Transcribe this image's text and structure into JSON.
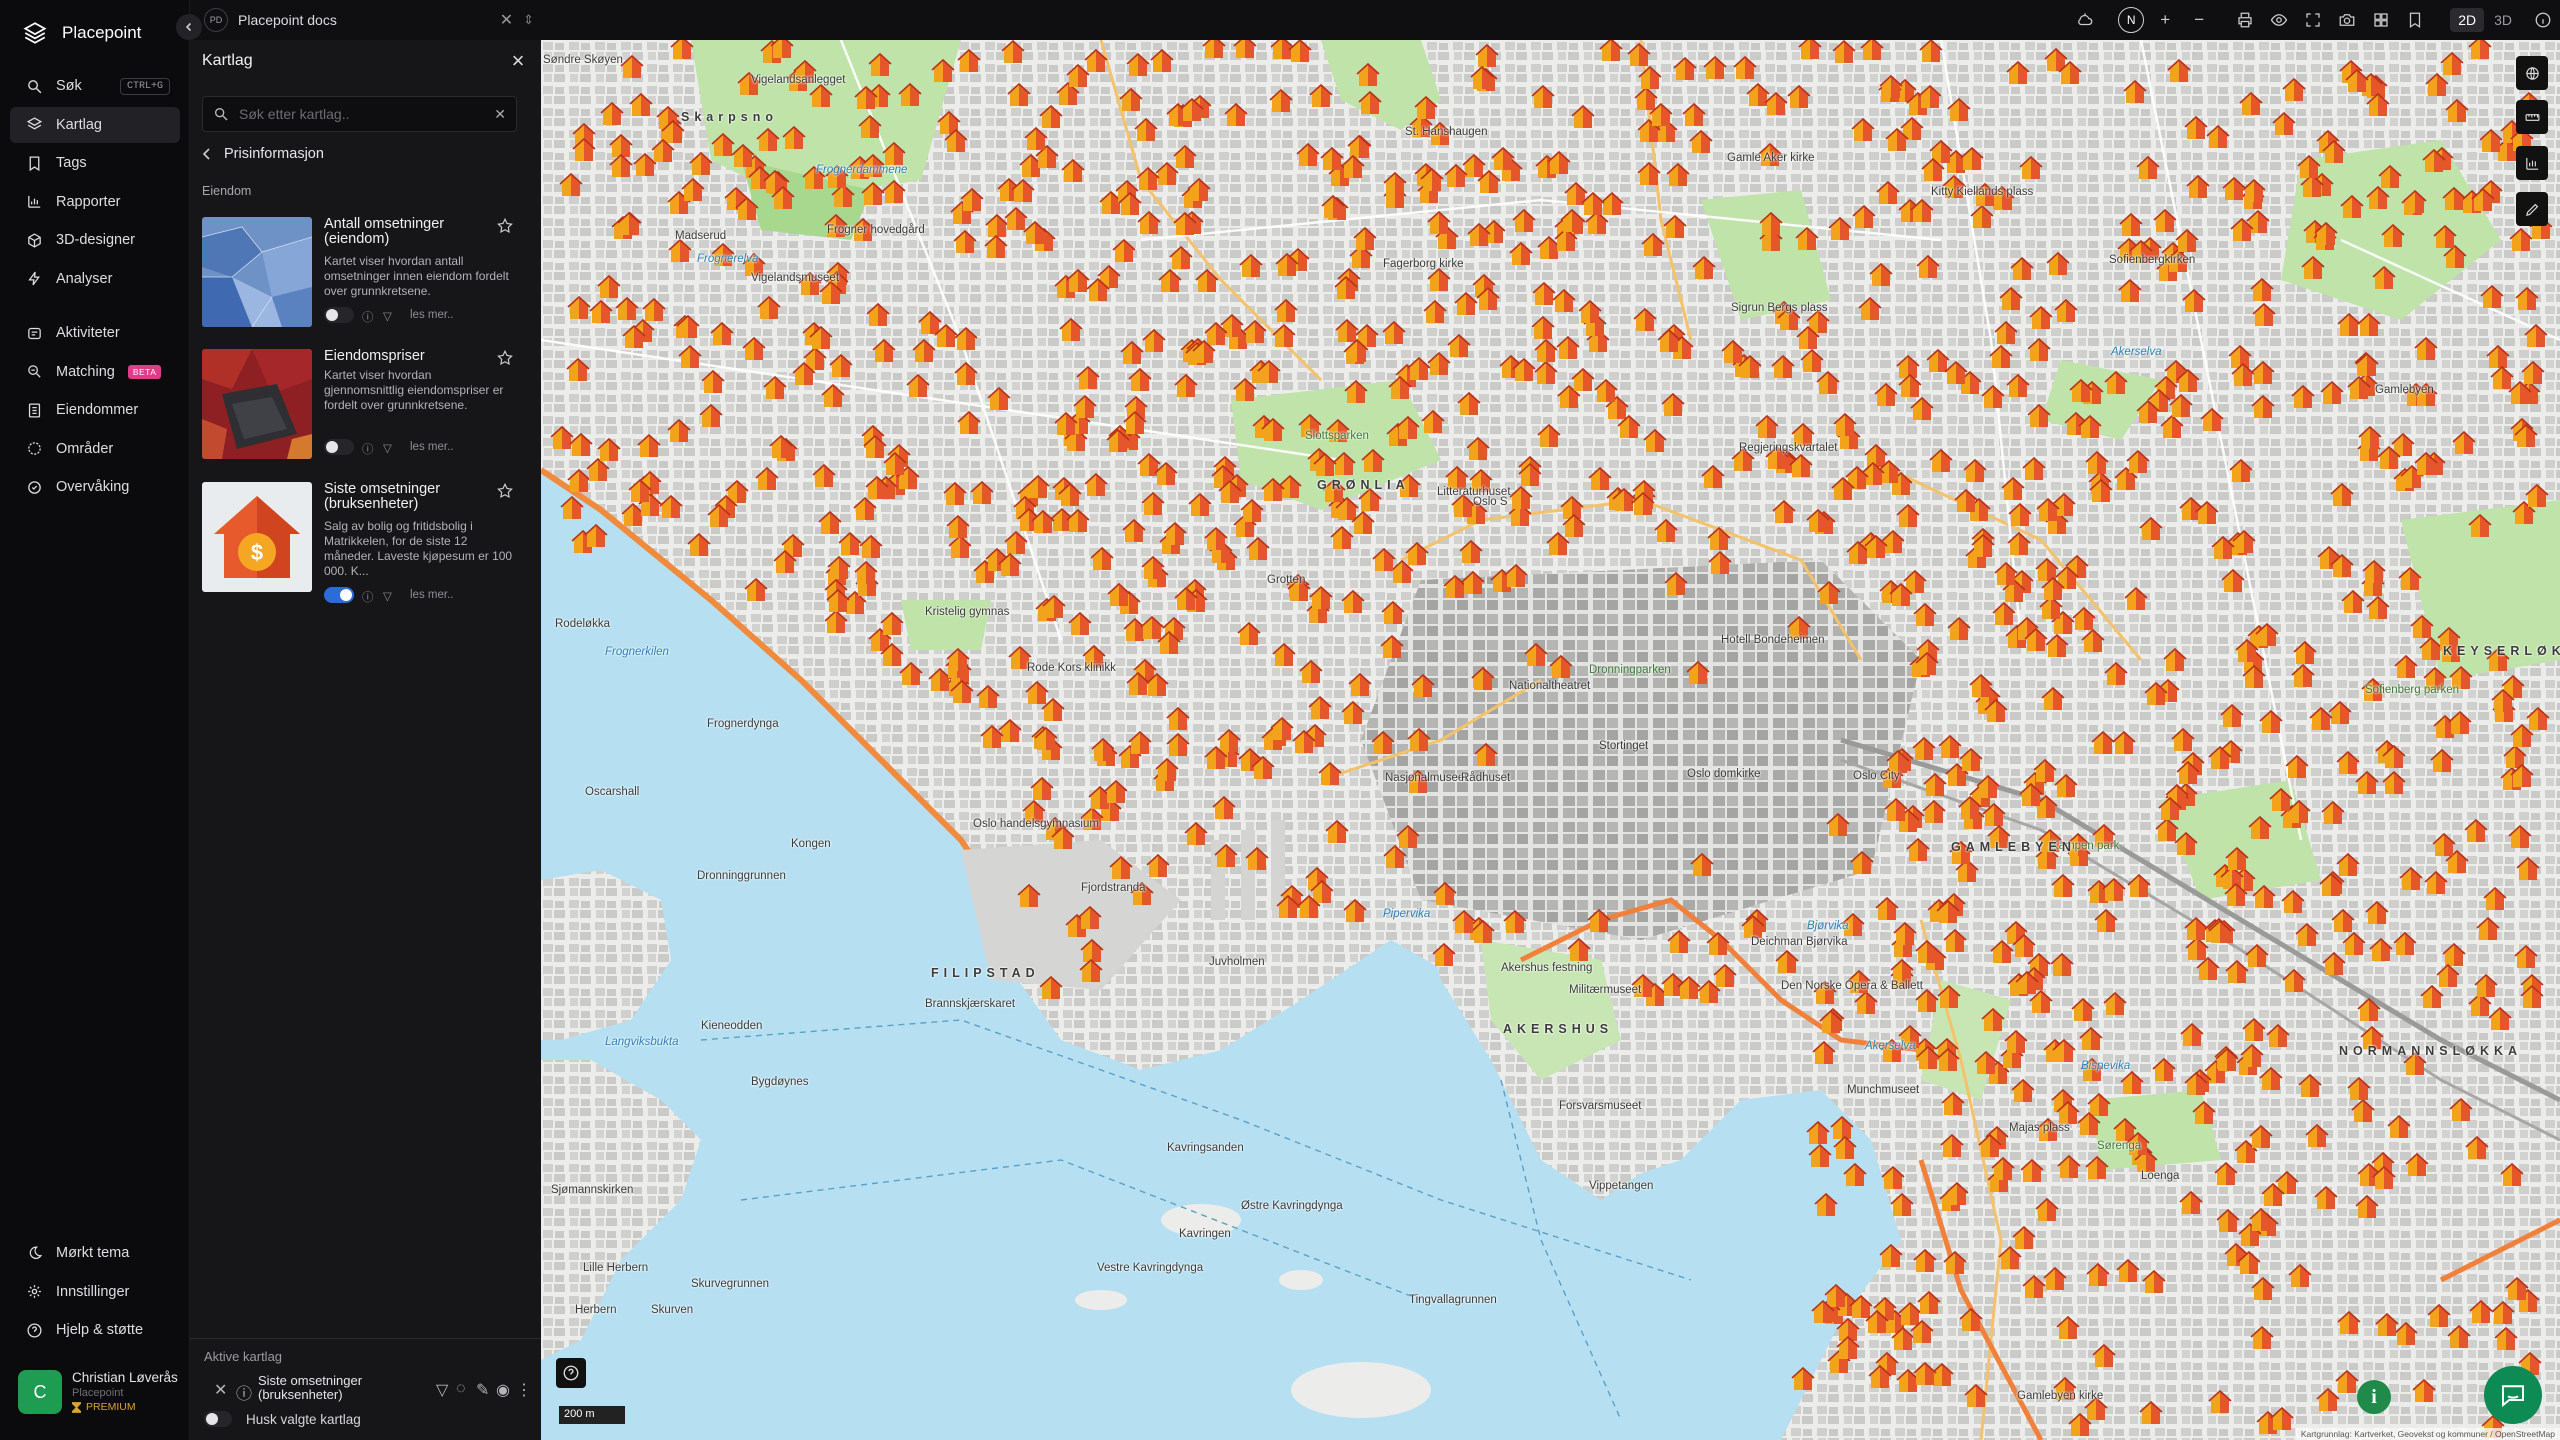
{
  "app": {
    "name": "Placepoint"
  },
  "nav": {
    "items": [
      {
        "label": "Søk",
        "shortcut": "CTRL+G",
        "icon": "search-icon"
      },
      {
        "label": "Kartlag",
        "icon": "layers-icon",
        "active": true
      },
      {
        "label": "Tags",
        "icon": "bookmark-icon"
      },
      {
        "label": "Rapporter",
        "icon": "bar-chart-icon"
      },
      {
        "label": "3D-designer",
        "icon": "cube-icon"
      },
      {
        "label": "Analyser",
        "icon": "bolt-icon"
      }
    ],
    "items2": [
      {
        "label": "Aktiviteter",
        "icon": "activity-icon"
      },
      {
        "label": "Matching",
        "badge": "BETA",
        "icon": "matching-icon"
      },
      {
        "label": "Eiendommer",
        "icon": "building-icon"
      },
      {
        "label": "Områder",
        "icon": "area-icon"
      },
      {
        "label": "Overvåking",
        "icon": "monitor-icon"
      }
    ],
    "bottom": [
      {
        "label": "Mørkt tema",
        "icon": "moon-icon"
      },
      {
        "label": "Innstillinger",
        "icon": "gear-icon"
      },
      {
        "label": "Hjelp & støtte",
        "icon": "help-icon"
      }
    ],
    "user": {
      "initial": "C",
      "name": "Christian Løverås",
      "org": "Placepoint",
      "plan": "PREMIUM"
    }
  },
  "tab": {
    "badge": "PD",
    "title": "Placepoint docs"
  },
  "toolbar": {
    "north": "N",
    "dim2": "2D",
    "dim3": "3D"
  },
  "panel": {
    "title": "Kartlag",
    "search_placeholder": "Søk etter kartlag..",
    "breadcrumb": "Prisinformasjon",
    "section": "Eiendom",
    "cards": [
      {
        "title": "Antall omsetninger (eiendom)",
        "desc": "Kartet viser hvordan antall omsetninger innen eiendom fordelt over grunnkretsene.",
        "more": "les mer..",
        "enabled": false
      },
      {
        "title": "Eiendomspriser",
        "desc": "Kartet viser hvordan gjennomsnittlig eiendomspriser er fordelt over grunnkretsene.",
        "more": "les mer..",
        "enabled": false
      },
      {
        "title": "Siste omsetninger (bruksenheter)",
        "desc": "Salg av bolig og fritidsbolig i Matrikkelen, for de siste 12 måneder. Laveste kjøpesum er 100 000. K...",
        "more": "les mer..",
        "enabled": true
      }
    ],
    "active_title": "Aktive kartlag",
    "active_layer": "Siste omsetninger (bruksenheter)",
    "remember": "Husk valgte kartlag"
  },
  "map": {
    "scale": "200 m",
    "attribution": "Kartgrunnlag: Kartverket, Geovekst og kommuner / OpenStreetMap",
    "labels": [
      {
        "t": "Søndre Skøyen",
        "c": ""
      },
      {
        "t": "Vigelandsanlegget",
        "c": ""
      },
      {
        "t": "Skarpsno",
        "c": "district"
      },
      {
        "t": "Frognerdammene",
        "c": "water"
      },
      {
        "t": "Madserud",
        "c": ""
      },
      {
        "t": "Frognerelva",
        "c": "water"
      },
      {
        "t": "Frogner hovedgård",
        "c": ""
      },
      {
        "t": "Vigelandsmuseet",
        "c": ""
      },
      {
        "t": "Frognerkilen",
        "c": "water"
      },
      {
        "t": "Rodeløkka",
        "c": ""
      },
      {
        "t": "Frognerdynga",
        "c": ""
      },
      {
        "t": "Oscarshall",
        "c": ""
      },
      {
        "t": "Kongen",
        "c": ""
      },
      {
        "t": "Dronninggrunnen",
        "c": ""
      },
      {
        "t": "Langviksbukta",
        "c": "water"
      },
      {
        "t": "Kieneodden",
        "c": ""
      },
      {
        "t": "Bygdøynes",
        "c": ""
      },
      {
        "t": "Sjømannskirken",
        "c": ""
      },
      {
        "t": "Lille Herbern",
        "c": ""
      },
      {
        "t": "Herbern",
        "c": ""
      },
      {
        "t": "Skurvegrunnen",
        "c": ""
      },
      {
        "t": "Skurven",
        "c": ""
      },
      {
        "t": "FILIPSTAD",
        "c": "district"
      },
      {
        "t": "Brannskjærskaret",
        "c": ""
      },
      {
        "t": "Juvholmen",
        "c": ""
      },
      {
        "t": "Kavringsanden",
        "c": ""
      },
      {
        "t": "Kavringen",
        "c": ""
      },
      {
        "t": "Østre Kavringdynga",
        "c": ""
      },
      {
        "t": "Vestre Kavringdynga",
        "c": ""
      },
      {
        "t": "Tingvallagrunnen",
        "c": ""
      },
      {
        "t": "Pipervika",
        "c": "water"
      },
      {
        "t": "AKERSHUS",
        "c": "district"
      },
      {
        "t": "Akershus festning",
        "c": ""
      },
      {
        "t": "Militærmuseet",
        "c": ""
      },
      {
        "t": "Forsvarsmuseet",
        "c": ""
      },
      {
        "t": "Vippetangen",
        "c": ""
      },
      {
        "t": "Nasjonalmuseet",
        "c": ""
      },
      {
        "t": "Rådhuset",
        "c": ""
      },
      {
        "t": "Nationaltheatret",
        "c": ""
      },
      {
        "t": "Stortinget",
        "c": ""
      },
      {
        "t": "Oslo domkirke",
        "c": ""
      },
      {
        "t": "Oslo City",
        "c": ""
      },
      {
        "t": "Deichman Bjørvika",
        "c": ""
      },
      {
        "t": "Den Norske Opera & Ballett",
        "c": ""
      },
      {
        "t": "Bjørvika",
        "c": "water"
      },
      {
        "t": "Akerselva",
        "c": "water"
      },
      {
        "t": "Munchmuseet",
        "c": ""
      },
      {
        "t": "Bispevika",
        "c": "water"
      },
      {
        "t": "Sørenga",
        "c": "green"
      },
      {
        "t": "Loenga",
        "c": ""
      },
      {
        "t": "Gamlebyen kirke",
        "c": ""
      },
      {
        "t": "GRØNLIA",
        "c": "district"
      },
      {
        "t": "Slottsparken",
        "c": "green"
      },
      {
        "t": "Litteraturhuset",
        "c": ""
      },
      {
        "t": "Grotten",
        "c": ""
      },
      {
        "t": "Dronningparken",
        "c": "green"
      },
      {
        "t": "Hotell Bondeheimen",
        "c": ""
      },
      {
        "t": "Regjeringskvartalet",
        "c": ""
      },
      {
        "t": "Sigrun Bergs plass",
        "c": ""
      },
      {
        "t": "Gamle Aker kirke",
        "c": ""
      },
      {
        "t": "St. Hanshaugen",
        "c": ""
      },
      {
        "t": "Fagerborg kirke",
        "c": ""
      },
      {
        "t": "Kristelig gymnas",
        "c": ""
      },
      {
        "t": "Rode Kors klinikk",
        "c": ""
      },
      {
        "t": "Oslo handelsgymnasium",
        "c": ""
      },
      {
        "t": "Fjordstranda",
        "c": ""
      },
      {
        "t": "Kitty Kiellands plass",
        "c": ""
      },
      {
        "t": "Akerselva",
        "c": "water"
      },
      {
        "t": "Sofienbergkirken",
        "c": ""
      },
      {
        "t": "Sofienberg parken",
        "c": "green"
      },
      {
        "t": "Kampen park",
        "c": "green"
      },
      {
        "t": "Majas plass",
        "c": ""
      },
      {
        "t": "Gamlebyen",
        "c": ""
      },
      {
        "t": "KEYSERLØKKA",
        "c": "district"
      },
      {
        "t": "NORMANNSLØKKA",
        "c": "district"
      },
      {
        "t": "GAMLEBYEN",
        "c": "district"
      },
      {
        "t": "Oslo S",
        "c": ""
      }
    ]
  }
}
